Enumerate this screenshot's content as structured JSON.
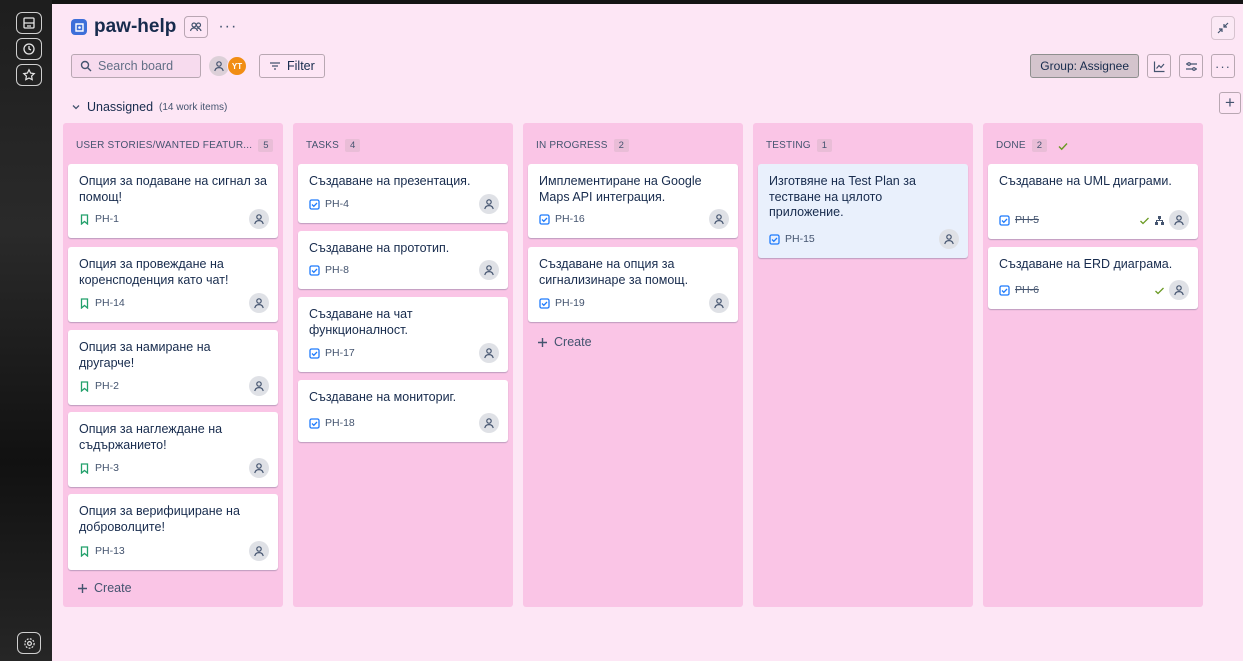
{
  "project": {
    "title": "paw-help"
  },
  "toolbar": {
    "search_placeholder": "Search board",
    "avatar_initials": "YT",
    "filter_label": "Filter",
    "group_label": "Group: Assignee"
  },
  "swimlane": {
    "title": "Unassigned",
    "count": "(14 work items)"
  },
  "columns": [
    {
      "name": "USER STORIES/WANTED FEATUR...",
      "count": "5",
      "cards": [
        {
          "title": "Опция за подаване на сигнал за помощ!",
          "key": "PH-1"
        },
        {
          "title": "Опция за провеждане на коренсподенция като чат!",
          "key": "PH-14"
        },
        {
          "title": "Опция за намиране на другарче!",
          "key": "PH-2"
        },
        {
          "title": "Опция за наглеждане на съдържанието!",
          "key": "PH-3"
        },
        {
          "title": "Опция за верифициране на доброволците!",
          "key": "PH-13"
        }
      ],
      "create_label": "Create"
    },
    {
      "name": "TASKS",
      "count": "4",
      "cards": [
        {
          "title": "Създаване на презентация.",
          "key": "PH-4"
        },
        {
          "title": "Създаване на прототип.",
          "key": "PH-8"
        },
        {
          "title": "Създаване на чат функционалност.",
          "key": "PH-17"
        },
        {
          "title": "Създаване на мониториг.",
          "key": "PH-18"
        }
      ]
    },
    {
      "name": "IN PROGRESS",
      "count": "2",
      "cards": [
        {
          "title": "Имплементиране на Google Maps API интеграция.",
          "key": "PH-16"
        },
        {
          "title": "Създаване на опция за сигнализинаре за помощ.",
          "key": "PH-19"
        }
      ],
      "create_label": "Create"
    },
    {
      "name": "TESTING",
      "count": "1",
      "cards": [
        {
          "title": "Изготвяне на Test Plan за тестване на цялото приложение.",
          "key": "PH-15"
        }
      ]
    },
    {
      "name": "DONE",
      "count": "2",
      "cards": [
        {
          "title": "Създаване на UML диаграми.",
          "key": "PH-5"
        },
        {
          "title": "Създаване на ERD диаграма.",
          "key": "PH-6"
        }
      ]
    }
  ],
  "colors": {
    "board_bg": "#fde6f5",
    "column_bg": "#fac5e6",
    "story_green": "#22a06b",
    "task_blue": "#1d7afc",
    "done_check": "#6a9a23",
    "avatar_orange": "#f18d13"
  }
}
